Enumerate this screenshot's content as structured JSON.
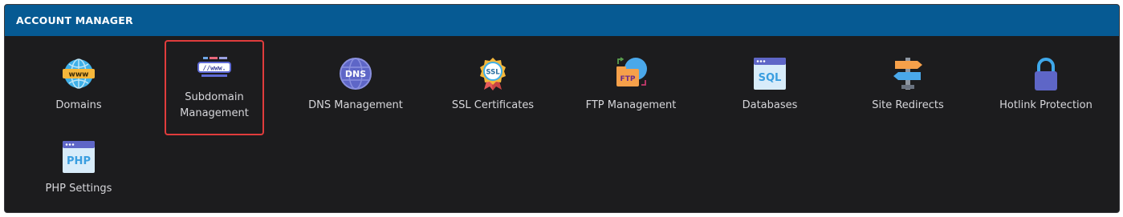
{
  "panel": {
    "title": "ACCOUNT MANAGER"
  },
  "tiles": [
    {
      "label": "Domains",
      "icon": "globe-www-icon"
    },
    {
      "label": "Subdomain Management",
      "icon": "url-bar-icon",
      "selected": true
    },
    {
      "label": "DNS Management",
      "icon": "dns-globe-icon"
    },
    {
      "label": "SSL Certificates",
      "icon": "ssl-badge-icon"
    },
    {
      "label": "FTP Management",
      "icon": "ftp-folder-icon"
    },
    {
      "label": "Databases",
      "icon": "sql-window-icon"
    },
    {
      "label": "Site Redirects",
      "icon": "signpost-icon"
    },
    {
      "label": "Hotlink Protection",
      "icon": "padlock-icon"
    },
    {
      "label": "PHP Settings",
      "icon": "php-window-icon"
    }
  ],
  "colors": {
    "header": "#065a93",
    "panel": "#1c1c1e",
    "selection": "#e03c3c"
  }
}
